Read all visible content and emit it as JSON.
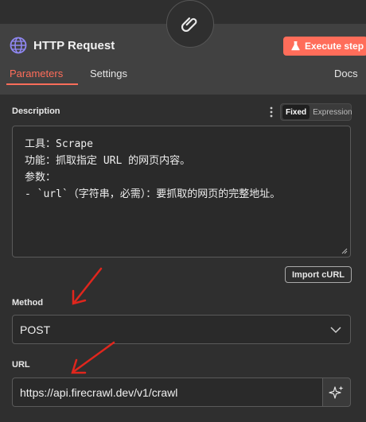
{
  "node": {
    "title": "HTTP Request",
    "execute_label": "Execute step",
    "icon": "globe-icon",
    "badge_icon": "paperclip-icon"
  },
  "tabs": [
    {
      "label": "Parameters",
      "active": true
    },
    {
      "label": "Settings",
      "active": false
    },
    {
      "label": "Docs",
      "active": false
    }
  ],
  "description": {
    "label": "Description",
    "mode_options": [
      "Fixed",
      "Expression"
    ],
    "mode_selected": "Fixed",
    "lines": [
      "工具：Scrape",
      "功能：抓取指定 URL 的网页内容。",
      "参数：",
      "- `url`（字符串，必需）：要抓取的网页的完整地址。"
    ]
  },
  "import_curl_label": "Import cURL",
  "method": {
    "label": "Method",
    "value": "POST"
  },
  "url": {
    "label": "URL",
    "value": "https://api.firecrawl.dev/v1/crawl"
  },
  "colors": {
    "accent": "#ff6d5a",
    "panel": "#414141",
    "content": "#2f2f2f",
    "input_bg": "#2a2a2a",
    "annotation_arrow": "#e0261d"
  }
}
